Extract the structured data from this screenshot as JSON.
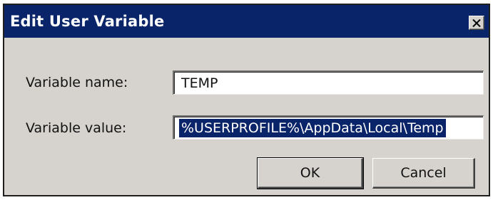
{
  "dialog": {
    "title": "Edit User Variable",
    "close_icon": "close-x-icon"
  },
  "fields": {
    "name_label": "Variable name:",
    "name_value": "TEMP",
    "value_label": "Variable value:",
    "value_value": "%USERPROFILE%\\AppData\\Local\\Temp",
    "value_selected": true
  },
  "buttons": {
    "ok_label": "OK",
    "cancel_label": "Cancel"
  },
  "colors": {
    "titlebar": "#0a246a",
    "dialog_face": "#d6d3ce",
    "selection": "#0a246a"
  }
}
